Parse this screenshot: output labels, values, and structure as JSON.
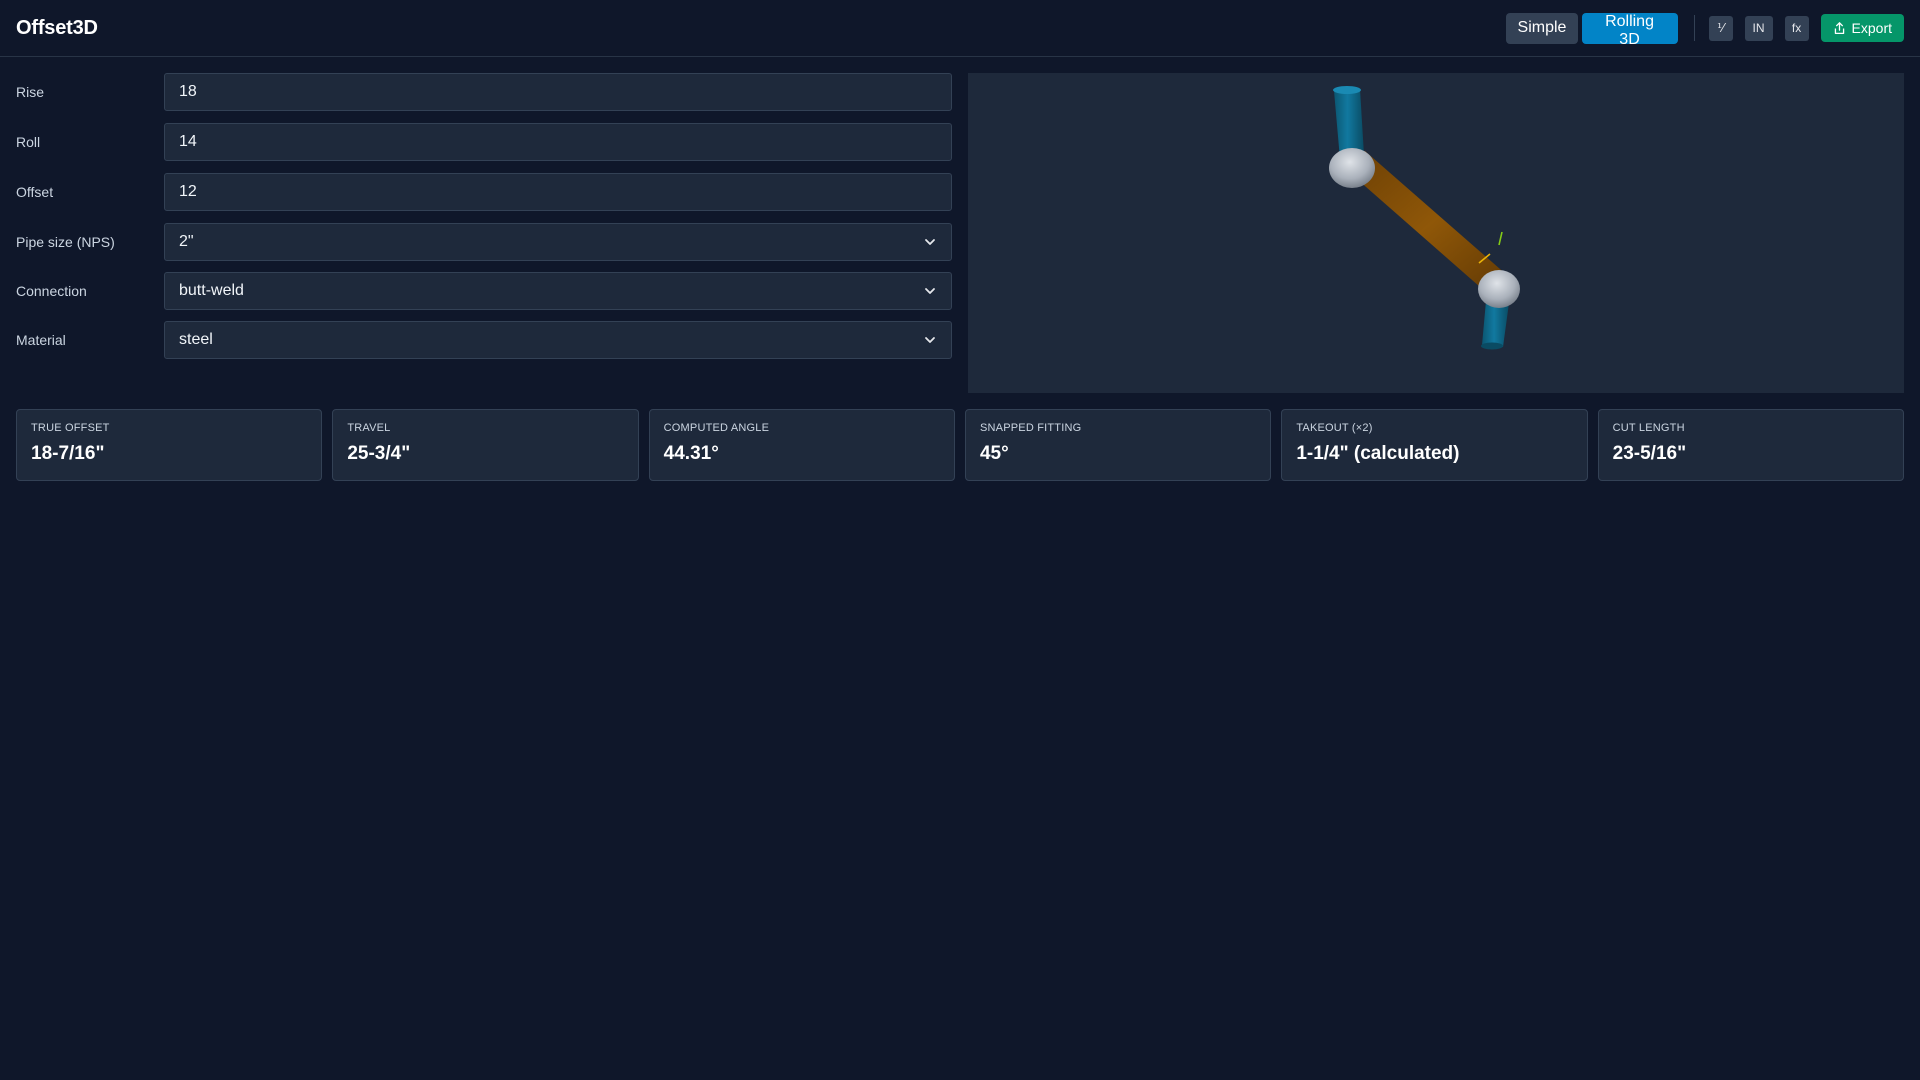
{
  "app": {
    "title": "Offset3D"
  },
  "toolbar": {
    "mode_simple": "Simple",
    "mode_rolling": "Rolling 3D",
    "btn_fraction": "⅟",
    "btn_units": "IN",
    "btn_formula": "fx",
    "export_label": "Export",
    "active_mode": "Rolling 3D",
    "colors": {
      "active": "#0284c7",
      "export": "#059669"
    }
  },
  "form": {
    "rise": {
      "label": "Rise",
      "value": "18"
    },
    "roll": {
      "label": "Roll",
      "value": "14"
    },
    "offset": {
      "label": "Offset",
      "value": "12"
    },
    "pipe_size": {
      "label": "Pipe size (NPS)",
      "value": "2\""
    },
    "connection": {
      "label": "Connection",
      "value": "butt-weld"
    },
    "material": {
      "label": "Material",
      "value": "steel"
    }
  },
  "viewer": {
    "colors": {
      "pipe_end": "#0e6f8f",
      "elbow": "#b8bec8",
      "travel_pipe": "#8a5206"
    }
  },
  "results": [
    {
      "label": "TRUE OFFSET",
      "value": "18-7/16\""
    },
    {
      "label": "TRAVEL",
      "value": "25-3/4\""
    },
    {
      "label": "COMPUTED ANGLE",
      "value": "44.31°"
    },
    {
      "label": "SNAPPED FITTING",
      "value": "45°"
    },
    {
      "label": "TAKEOUT (×2)",
      "value": "1-1/4\" (calculated)"
    },
    {
      "label": "CUT LENGTH",
      "value": "23-5/16\""
    }
  ]
}
